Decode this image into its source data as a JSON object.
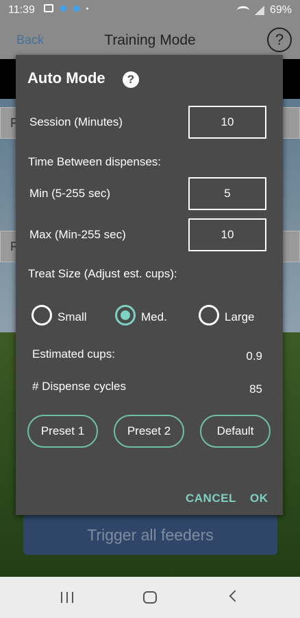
{
  "status_bar": {
    "time": "11:39",
    "battery": "69%"
  },
  "background": {
    "nav": {
      "back": "Back",
      "title": "Training Mode",
      "help": "?"
    },
    "card_letters": [
      "F",
      "F"
    ],
    "trigger_button": "Trigger all feeders"
  },
  "dialog": {
    "title": "Auto Mode",
    "help": "?",
    "session_label": "Session (Minutes)",
    "session_value": "10",
    "time_between_label": "Time Between dispenses:",
    "min_label": "Min (5-255 sec)",
    "min_value": "5",
    "max_label": "Max (Min-255 sec)",
    "max_value": "10",
    "treat_size_label": "Treat Size (Adjust est. cups):",
    "treat_sizes": [
      {
        "label": "Small",
        "selected": false
      },
      {
        "label": "Med.",
        "selected": true
      },
      {
        "label": "Large",
        "selected": false
      }
    ],
    "estimated_cups_label": "Estimated cups:",
    "estimated_cups_value": "0.9",
    "dispense_cycles_label": "# Dispense cycles",
    "dispense_cycles_value": "85",
    "presets": [
      "Preset 1",
      "Preset 2",
      "Default"
    ],
    "cancel": "CANCEL",
    "ok": "OK"
  },
  "colors": {
    "accent": "#7fd0c0",
    "dialog_bg": "#4a4a4a",
    "trigger_bg": "#2f4668"
  }
}
